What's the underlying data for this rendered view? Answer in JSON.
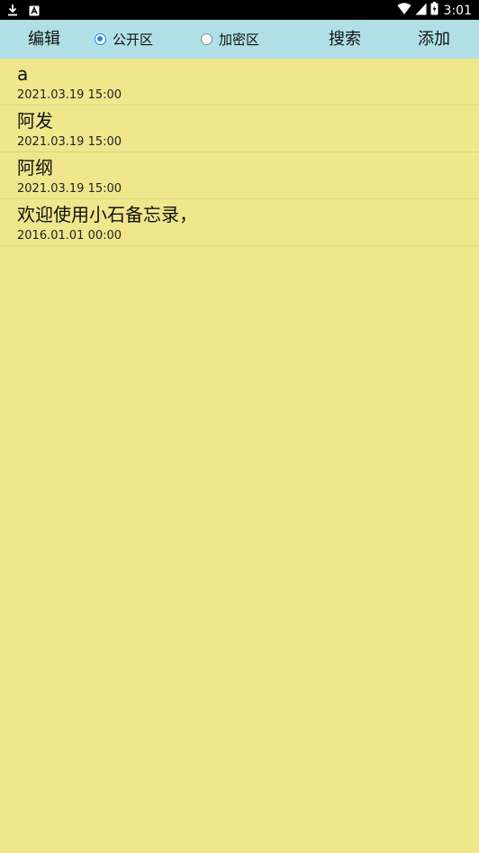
{
  "status_bar": {
    "time": "3:01",
    "icons": [
      "download-icon",
      "a-box-icon",
      "wifi-icon",
      "cell-signal-icon",
      "battery-icon"
    ]
  },
  "toolbar": {
    "edit_label": "编辑",
    "public_label": "公开区",
    "encrypted_label": "加密区",
    "search_label": "搜索",
    "add_label": "添加",
    "selected_zone": "public",
    "background": "#b0e0e6"
  },
  "colors": {
    "page_background": "#f0e68c",
    "radio_accent": "#1e88e5"
  },
  "notes": [
    {
      "title": "a",
      "date": "2021.03.19 15:00"
    },
    {
      "title": "阿发",
      "date": "2021.03.19 15:00"
    },
    {
      "title": "阿纲",
      "date": "2021.03.19 15:00"
    },
    {
      "title": "欢迎使用小石备忘录，",
      "date": "2016.01.01 00:00"
    }
  ]
}
